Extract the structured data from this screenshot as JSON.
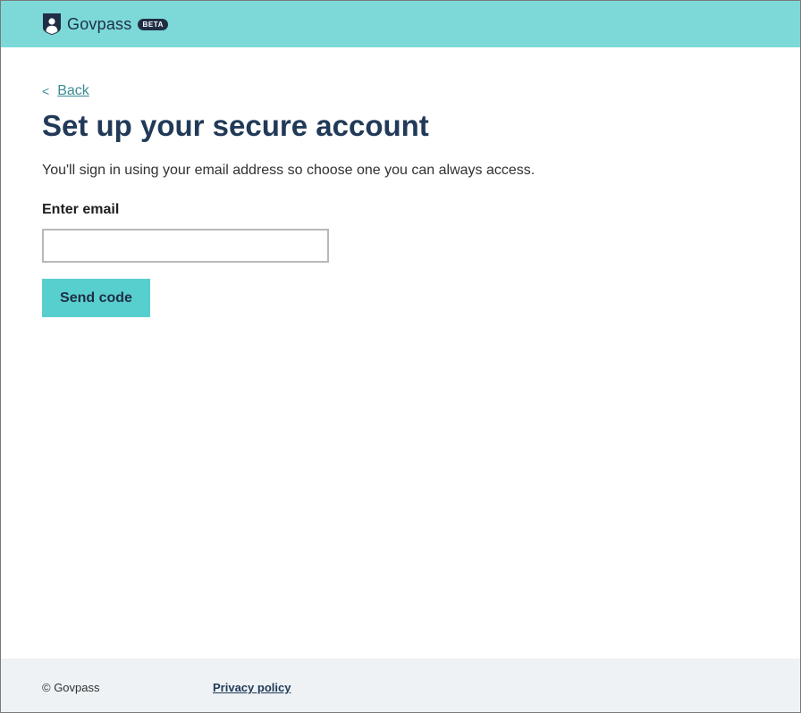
{
  "header": {
    "brand_name": "Govpass",
    "badge": "BETA",
    "logo_icon": "shield-person-icon"
  },
  "nav": {
    "back_chevron": "<",
    "back_label": "Back"
  },
  "main": {
    "title": "Set up your secure account",
    "intro": "You'll sign in using your email address so choose one you can always access.",
    "email_label": "Enter email",
    "email_value": "",
    "email_placeholder": "",
    "submit_label": "Send code"
  },
  "footer": {
    "copyright": "© Govpass",
    "privacy_label": "Privacy policy"
  },
  "colors": {
    "header_bg": "#7dd9d8",
    "button_bg": "#58cfcf",
    "title_color": "#213a58",
    "link_color": "#3a8b95",
    "footer_bg": "#eef2f5"
  }
}
